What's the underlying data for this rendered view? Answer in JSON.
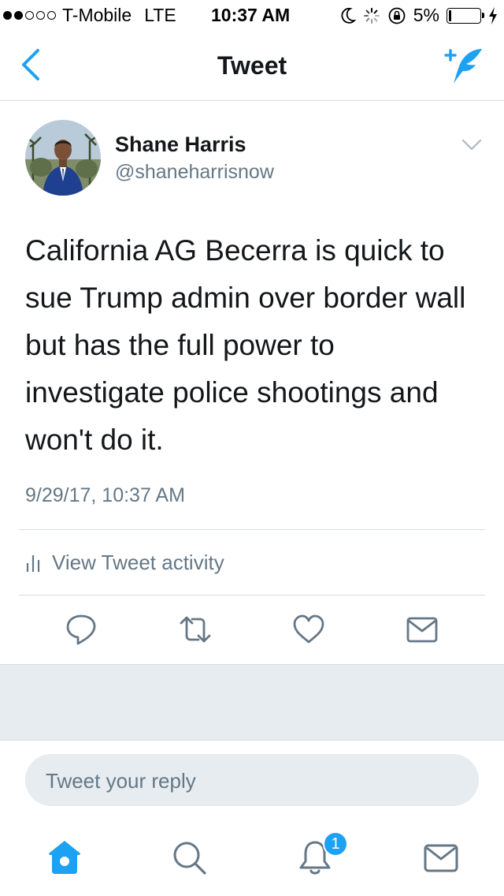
{
  "status_bar": {
    "carrier": "T-Mobile",
    "network": "LTE",
    "time": "10:37 AM",
    "battery": "5%",
    "battery_level": 0.05,
    "signal_bars_filled": 2,
    "signal_bars_total": 5
  },
  "nav": {
    "title": "Tweet",
    "back_icon": "chevron-left-icon",
    "compose_icon": "compose-tweet-icon"
  },
  "tweet": {
    "name": "Shane Harris",
    "handle": "@shaneharrisnow",
    "text": "California AG Becerra is quick to sue Trump admin over border wall but has the full power to investigate police shootings and won't do it.",
    "timestamp": "9/29/17, 10:37 AM",
    "activity_label": "View Tweet activity"
  },
  "reply": {
    "placeholder": "Tweet your reply"
  },
  "tabbar": {
    "notifications_badge": "1"
  },
  "colors": {
    "accent": "#1da1f2",
    "text": "#14171a",
    "secondary": "#657786",
    "divider": "#d8dde1",
    "band": "#e6ecf0"
  }
}
